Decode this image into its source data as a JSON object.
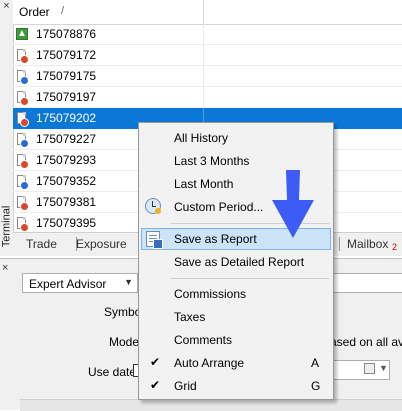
{
  "terminal": {
    "close_glyph": "×",
    "label": "Terminal",
    "columns": {
      "order": "Order",
      "sort_indicator": "/"
    },
    "rows": [
      {
        "ticket": "175078876",
        "icon": "arrow-up-icon",
        "selected": false
      },
      {
        "ticket": "175079172",
        "icon": "document-red-icon",
        "selected": false
      },
      {
        "ticket": "175079175",
        "icon": "document-blue-icon",
        "selected": false
      },
      {
        "ticket": "175079197",
        "icon": "document-red-icon",
        "selected": false
      },
      {
        "ticket": "175079202",
        "icon": "document-red-icon",
        "selected": true
      },
      {
        "ticket": "175079227",
        "icon": "document-blue-icon",
        "selected": false
      },
      {
        "ticket": "175079293",
        "icon": "document-red-icon",
        "selected": false
      },
      {
        "ticket": "175079352",
        "icon": "document-blue-icon",
        "selected": false
      },
      {
        "ticket": "175079381",
        "icon": "document-red-icon",
        "selected": false
      },
      {
        "ticket": "175079395",
        "icon": "document-red-icon",
        "selected": false
      }
    ],
    "tabs": {
      "trade": "Trade",
      "exposure": "Exposure",
      "mailbox": "Mailbox",
      "mailbox_count": "2"
    }
  },
  "tester": {
    "close_glyph": "×",
    "expert_select": "Expert Advisor",
    "symbol_label": "Symbol",
    "model_label": "Model",
    "model_desc": "ased on all avai",
    "use_date_label": "Use date"
  },
  "context_menu": {
    "all_history": "All History",
    "last_3_months": "Last 3 Months",
    "last_month": "Last Month",
    "custom_period": "Custom Period...",
    "save_as_report": "Save as Report",
    "save_as_detailed_report": "Save as Detailed Report",
    "commissions": "Commissions",
    "taxes": "Taxes",
    "comments": "Comments",
    "auto_arrange": "Auto Arrange",
    "auto_arrange_key": "A",
    "grid": "Grid",
    "grid_key": "G",
    "check_glyph": "✔",
    "highlighted_item": "Save as Report"
  },
  "colors": {
    "selection": "#0b78d7",
    "menu_highlight": "#cce4f7",
    "annotation_arrow": "#3d5cf5"
  }
}
